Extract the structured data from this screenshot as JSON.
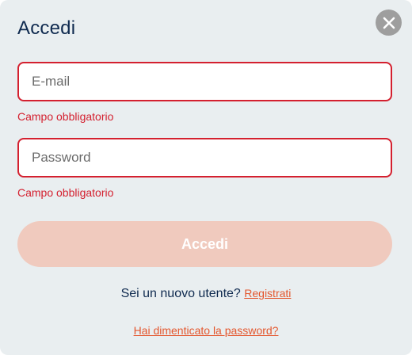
{
  "modal": {
    "title": "Accedi",
    "close_icon": "close-icon"
  },
  "form": {
    "email": {
      "placeholder": "E-mail",
      "value": "",
      "error": "Campo obbligatorio"
    },
    "password": {
      "placeholder": "Password",
      "value": "",
      "error": "Campo obbligatorio"
    },
    "submit_label": "Accedi"
  },
  "footer": {
    "new_user_text": "Sei un nuovo utente?",
    "register_label": "Registrati",
    "forgot_password_label": "Hai dimenticato la password?"
  },
  "colors": {
    "title": "#0f2a4f",
    "error": "#d4202f",
    "link": "#e4572e",
    "submit_disabled_bg": "#f0cabe",
    "modal_bg": "#e9eef0",
    "close_button_bg": "#9e9e9e"
  }
}
